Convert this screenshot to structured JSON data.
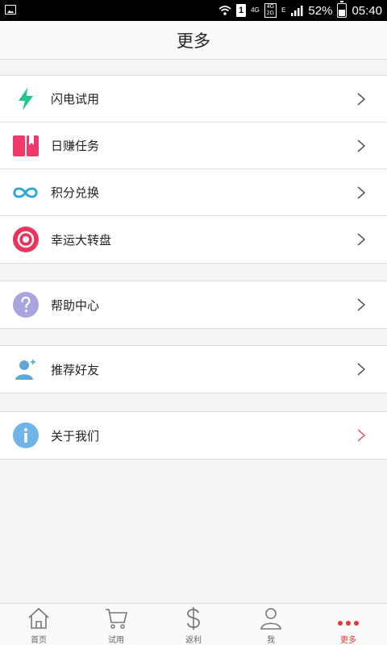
{
  "status_bar": {
    "net_small": "4G",
    "net_top": "4G",
    "net_bottom": "2G",
    "net_e": "E",
    "sim": "1",
    "battery": "52%",
    "time": "05:40"
  },
  "header": {
    "title": "更多"
  },
  "groups": [
    {
      "items": [
        {
          "label": "闪电试用",
          "icon": "lightning-icon",
          "color": "#1dc88a"
        },
        {
          "label": "日赚任务",
          "icon": "book-icon",
          "color": "#f0386b"
        },
        {
          "label": "积分兑换",
          "icon": "infinity-icon",
          "color": "#29a6e0"
        },
        {
          "label": "幸运大转盘",
          "icon": "target-icon",
          "color": "#e8345a"
        }
      ]
    },
    {
      "items": [
        {
          "label": "帮助中心",
          "icon": "question-icon",
          "color": "#a9a3e0"
        }
      ]
    },
    {
      "items": [
        {
          "label": "推荐好友",
          "icon": "user-add-icon",
          "color": "#5fa8d8"
        }
      ]
    },
    {
      "items": [
        {
          "label": "关于我们",
          "icon": "info-icon",
          "color": "#6fb4e6"
        }
      ]
    }
  ],
  "tabs": [
    {
      "label": "首页",
      "icon": "home-icon"
    },
    {
      "label": "试用",
      "icon": "cart-icon"
    },
    {
      "label": "返利",
      "icon": "dollar-icon"
    },
    {
      "label": "我",
      "icon": "person-icon"
    },
    {
      "label": "更多",
      "icon": "more-dots-icon",
      "active": true
    }
  ],
  "colors": {
    "active": "#e53935",
    "chevron": "#555555",
    "chevron_last": "#e05a6e"
  }
}
